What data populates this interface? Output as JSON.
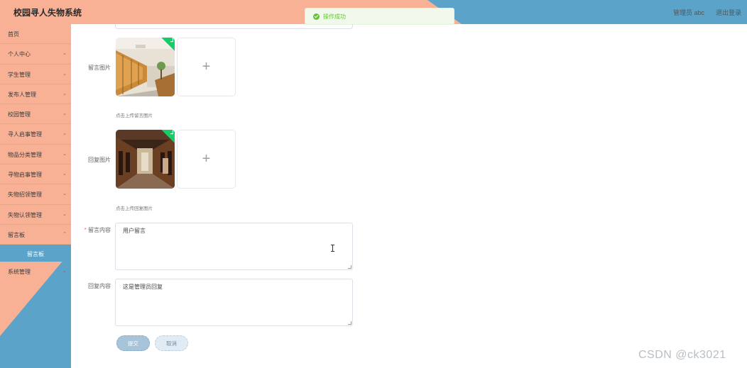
{
  "header": {
    "title": "校园寻人失物系统",
    "user": "管理员 abc",
    "logout": "退出登录",
    "colors": {
      "salmon": "#f8b195",
      "blue": "#5ba3c8"
    }
  },
  "toast": {
    "message": "操作成功",
    "type": "success"
  },
  "sidebar": {
    "items": [
      {
        "label": "首页",
        "has_children": false
      },
      {
        "label": "个人中心",
        "has_children": true
      },
      {
        "label": "学生管理",
        "has_children": true
      },
      {
        "label": "发布人管理",
        "has_children": true
      },
      {
        "label": "校园管理",
        "has_children": true
      },
      {
        "label": "寻人启事管理",
        "has_children": true
      },
      {
        "label": "物品分类管理",
        "has_children": true
      },
      {
        "label": "寻物启事管理",
        "has_children": true
      },
      {
        "label": "失物招领管理",
        "has_children": true
      },
      {
        "label": "失物认领管理",
        "has_children": true
      },
      {
        "label": "留言板",
        "has_children": true,
        "expanded": true
      }
    ],
    "active_sub_item": "留言板",
    "footer_item": {
      "label": "系统管理",
      "has_children": true
    }
  },
  "form": {
    "image1": {
      "label": "留言图片",
      "hint": "点击上传留言图片",
      "uploaded": true
    },
    "image2": {
      "label": "回复图片",
      "hint": "点击上传回复图片",
      "uploaded": true
    },
    "message": {
      "label": "留言内容",
      "required": true,
      "value": "用户留言"
    },
    "reply": {
      "label": "回复内容",
      "required": false,
      "value": "这是管理员回复"
    },
    "submit_label": "提交",
    "cancel_label": "取消"
  },
  "watermark": "CSDN @ck3021"
}
